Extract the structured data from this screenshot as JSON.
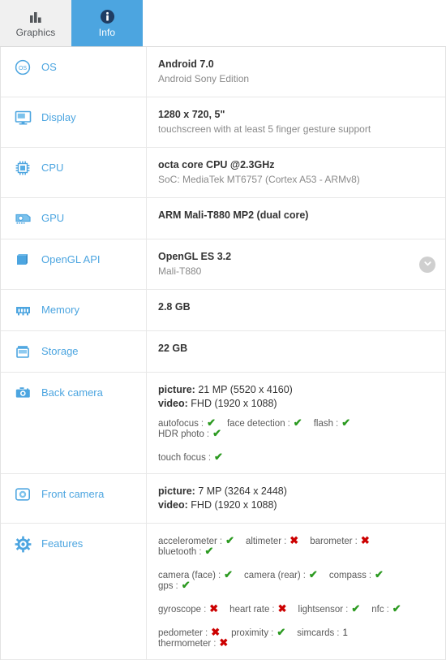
{
  "tabs": [
    {
      "id": "graphics",
      "label": "Graphics",
      "icon": "bar-chart-icon",
      "active": false
    },
    {
      "id": "info",
      "label": "Info",
      "icon": "info-circle-icon",
      "active": true
    }
  ],
  "colors": {
    "accent": "#4ca5e0",
    "tab_inactive_bg": "#f0f0f0",
    "label_blue": "#4ca5e0",
    "yes_green": "#2c9a21",
    "no_red": "#cc0000",
    "secondary_text": "#8a8a8a"
  },
  "marks": {
    "yes": "✔",
    "no": "✖"
  },
  "rows": [
    {
      "id": "os",
      "label": "OS",
      "icon": "os-circle-icon",
      "primary": "Android 7.0",
      "secondary": "Android Sony Edition"
    },
    {
      "id": "display",
      "label": "Display",
      "icon": "monitor-icon",
      "primary": "1280 x 720, 5\"",
      "secondary": "touchscreen with at least 5 finger gesture support"
    },
    {
      "id": "cpu",
      "label": "CPU",
      "icon": "cpu-chip-icon",
      "primary": "octa core CPU @2.3GHz",
      "secondary": "SoC: MediaTek MT6757 (Cortex A53 - ARMv8)"
    },
    {
      "id": "gpu",
      "label": "GPU",
      "icon": "gpu-card-icon",
      "primary": "ARM Mali-T880 MP2 (dual core)",
      "secondary": ""
    },
    {
      "id": "opengl-api",
      "label": "OpenGL API",
      "icon": "cube-icon",
      "primary": "OpenGL ES 3.2",
      "secondary": "Mali-T880",
      "expandable": true,
      "expand_icon": "chevron-down-icon"
    },
    {
      "id": "memory",
      "label": "Memory",
      "icon": "ram-icon",
      "primary": "2.8 GB",
      "secondary": ""
    },
    {
      "id": "storage",
      "label": "Storage",
      "icon": "storage-icon",
      "primary": "22 GB",
      "secondary": ""
    }
  ],
  "back_camera": {
    "id": "back-camera",
    "label": "Back camera",
    "icon": "camera-icon",
    "picture_label": "picture:",
    "picture_value": "21 MP (5520 x 4160)",
    "video_label": "video:",
    "video_value": "FHD (1920 x 1088)",
    "capability_lines": [
      [
        {
          "name": "autofocus",
          "value": "yes"
        },
        {
          "name": "face detection",
          "value": "yes"
        },
        {
          "name": "flash",
          "value": "yes"
        },
        {
          "name": "HDR photo",
          "value": "yes"
        }
      ],
      [
        {
          "name": "touch focus",
          "value": "yes"
        }
      ]
    ]
  },
  "front_camera": {
    "id": "front-camera",
    "label": "Front camera",
    "icon": "front-camera-icon",
    "picture_label": "picture:",
    "picture_value": "7 MP (3264 x 2448)",
    "video_label": "video:",
    "video_value": "FHD (1920 x 1088)"
  },
  "features": {
    "id": "features",
    "label": "Features",
    "icon": "gear-icon",
    "capability_lines": [
      [
        {
          "name": "accelerometer",
          "value": "yes"
        },
        {
          "name": "altimeter",
          "value": "no"
        },
        {
          "name": "barometer",
          "value": "no"
        },
        {
          "name": "bluetooth",
          "value": "yes"
        }
      ],
      [
        {
          "name": "camera (face)",
          "value": "yes"
        },
        {
          "name": "camera (rear)",
          "value": "yes"
        },
        {
          "name": "compass",
          "value": "yes"
        },
        {
          "name": "gps",
          "value": "yes"
        }
      ],
      [
        {
          "name": "gyroscope",
          "value": "no"
        },
        {
          "name": "heart rate",
          "value": "no"
        },
        {
          "name": "lightsensor",
          "value": "yes"
        },
        {
          "name": "nfc",
          "value": "yes"
        }
      ],
      [
        {
          "name": "pedometer",
          "value": "no"
        },
        {
          "name": "proximity",
          "value": "yes"
        },
        {
          "name": "simcards",
          "value": "1"
        },
        {
          "name": "thermometer",
          "value": "no"
        }
      ]
    ]
  }
}
